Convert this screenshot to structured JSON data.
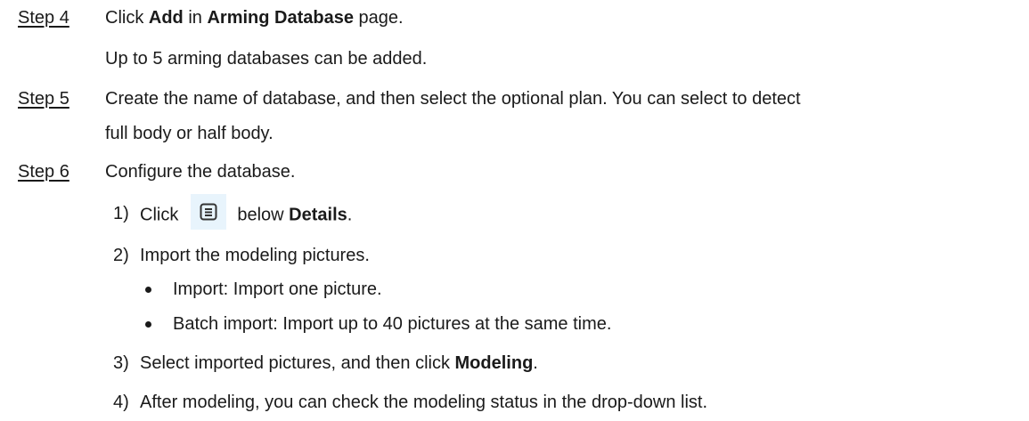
{
  "step4": {
    "label": "Step 4",
    "text_before": "Click ",
    "bold1": "Add",
    "text_mid": " in ",
    "bold2": "Arming Database",
    "text_after": " page.",
    "note": "Up to 5 arming databases can be added."
  },
  "step5": {
    "label": "Step 5",
    "line1": "Create the name of database, and then select the optional plan. You can select to detect",
    "line2": "full body or half body."
  },
  "step6": {
    "label": "Step 6",
    "text": "Configure the database.",
    "sub1": {
      "num": "1)",
      "before": "Click",
      "icon": "details-list-icon",
      "after": "below ",
      "bold": "Details",
      "end": "."
    },
    "sub2": {
      "num": "2)",
      "text": "Import the modeling pictures.",
      "bullets": [
        "Import: Import one picture.",
        "Batch import: Import up to 40 pictures at the same time."
      ]
    },
    "sub3": {
      "num": "3)",
      "before": "Select imported pictures, and then click ",
      "bold": "Modeling",
      "end": "."
    },
    "sub4": {
      "num": "4)",
      "text": "After modeling, you can check the modeling status in the drop-down list."
    }
  },
  "colors": {
    "text": "#1a1a1a",
    "icon_bg": "#e8f4fc"
  }
}
